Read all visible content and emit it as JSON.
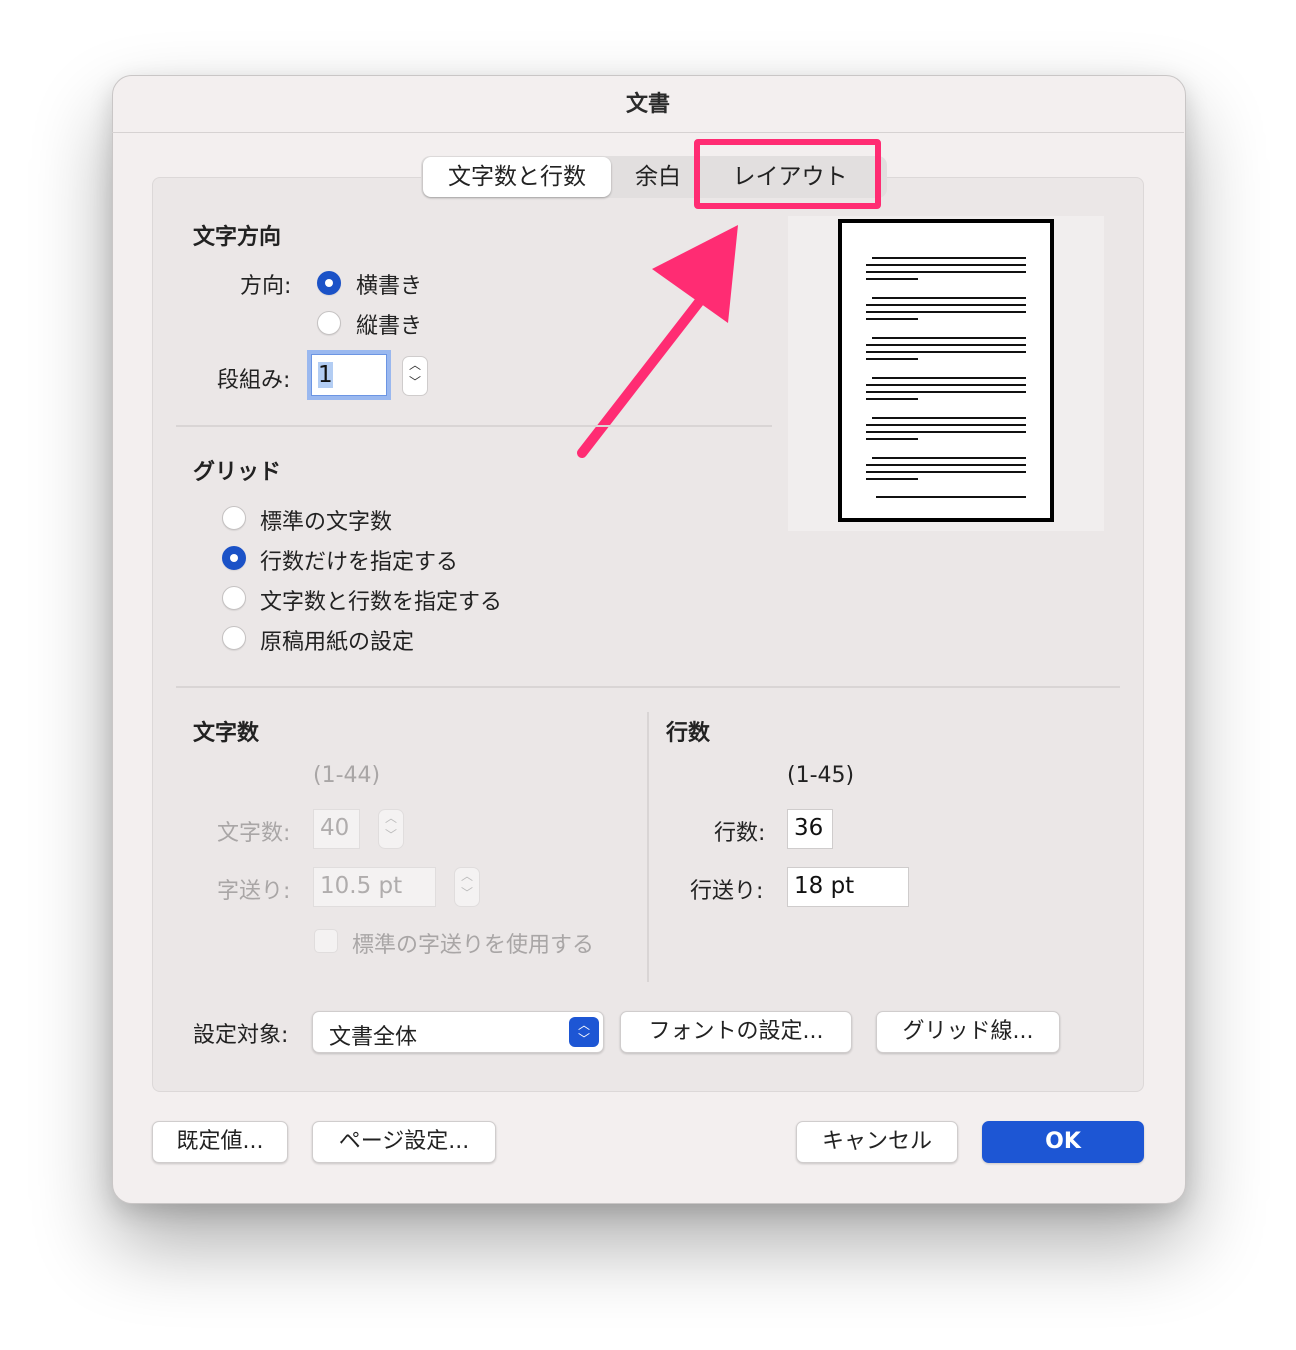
{
  "window": {
    "title": "文書"
  },
  "tabs": [
    {
      "label": "文字数と行数",
      "active": true
    },
    {
      "label": "余白",
      "active": false
    },
    {
      "label": "レイアウト",
      "active": false
    }
  ],
  "text_direction": {
    "heading": "文字方向",
    "direction_label": "方向:",
    "options": [
      {
        "label": "横書き",
        "selected": true
      },
      {
        "label": "縦書き",
        "selected": false
      }
    ],
    "columns_label": "段組み:",
    "columns_value": "1"
  },
  "grid": {
    "heading": "グリッド",
    "options": [
      {
        "label": "標準の文字数",
        "selected": false
      },
      {
        "label": "行数だけを指定する",
        "selected": true
      },
      {
        "label": "文字数と行数を指定する",
        "selected": false
      },
      {
        "label": "原稿用紙の設定",
        "selected": false
      }
    ]
  },
  "chars": {
    "heading": "文字数",
    "range": "(1-44)",
    "count_label": "文字数:",
    "count_value": "40",
    "pitch_label": "字送り:",
    "pitch_value": "10.5 pt",
    "default_pitch_label": "標準の字送りを使用する"
  },
  "lines": {
    "heading": "行数",
    "range": "(1-45)",
    "count_label": "行数:",
    "count_value": "36",
    "pitch_label": "行送り:",
    "pitch_value": "18 pt"
  },
  "apply_to": {
    "label": "設定対象:",
    "value": "文書全体"
  },
  "buttons": {
    "font_settings": "フォントの設定...",
    "grid_lines": "グリッド線...",
    "default": "既定値...",
    "page_setup": "ページ設定...",
    "cancel": "キャンセル",
    "ok": "OK"
  },
  "icons": {
    "stepper": "stepper-icon",
    "select": "updown-chevron-icon",
    "annotation": "pink-arrow-icon"
  },
  "colors": {
    "accent": "#1d56d4",
    "highlight": "#ff2c73"
  }
}
